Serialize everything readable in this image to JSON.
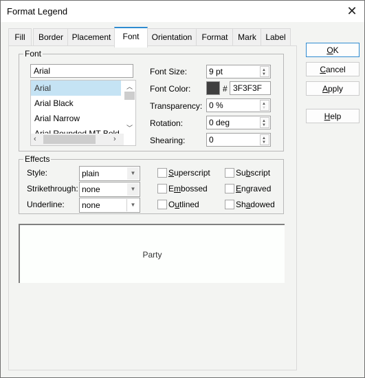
{
  "window": {
    "title": "Format Legend",
    "close_icon": "close-icon"
  },
  "tabs": [
    {
      "label": "Fill"
    },
    {
      "label": "Border"
    },
    {
      "label": "Placement"
    },
    {
      "label": "Font",
      "active": true
    },
    {
      "label": "Orientation"
    },
    {
      "label": "Format"
    },
    {
      "label": "Mark"
    },
    {
      "label": "Label"
    }
  ],
  "font_group": {
    "title": "Font",
    "font_name_value": "Arial",
    "font_list": [
      "Arial",
      "Arial Black",
      "Arial Narrow",
      "Arial Rounded MT Bold"
    ],
    "selected_font": "Arial",
    "font_size": {
      "label": "Font Size:",
      "value": "9 pt"
    },
    "font_color": {
      "label": "Font Color:",
      "hash": "#",
      "value": "3F3F3F",
      "swatch": "#3f3f3f"
    },
    "transparency": {
      "label": "Transparency:",
      "value": "0 %"
    },
    "rotation": {
      "label": "Rotation:",
      "value": "0 deg"
    },
    "shearing": {
      "label": "Shearing:",
      "value": "0"
    }
  },
  "effects_group": {
    "title": "Effects",
    "style": {
      "label": "Style:",
      "value": "plain"
    },
    "strikethrough": {
      "label": "Strikethrough:",
      "value": "none"
    },
    "underline": {
      "label": "Underline:",
      "value": "none"
    },
    "checkboxes": {
      "superscript": {
        "pre": "",
        "ul": "S",
        "post": "uperscript",
        "checked": false
      },
      "subscript": {
        "pre": "Su",
        "ul": "b",
        "post": "script",
        "checked": false
      },
      "embossed": {
        "pre": "E",
        "ul": "m",
        "post": "bossed",
        "checked": false
      },
      "engraved": {
        "pre": "",
        "ul": "E",
        "post": "ngraved",
        "checked": false
      },
      "outlined": {
        "pre": "O",
        "ul": "u",
        "post": "tlined",
        "checked": false
      },
      "shadowed": {
        "pre": "Sh",
        "ul": "a",
        "post": "dowed",
        "checked": false
      }
    }
  },
  "preview": {
    "text": "Party"
  },
  "buttons": {
    "ok": {
      "ul": "O",
      "post": "K"
    },
    "cancel": {
      "ul": "C",
      "post": "ancel"
    },
    "apply": {
      "ul": "A",
      "post": "pply"
    },
    "help": {
      "ul": "H",
      "post": "elp"
    }
  }
}
